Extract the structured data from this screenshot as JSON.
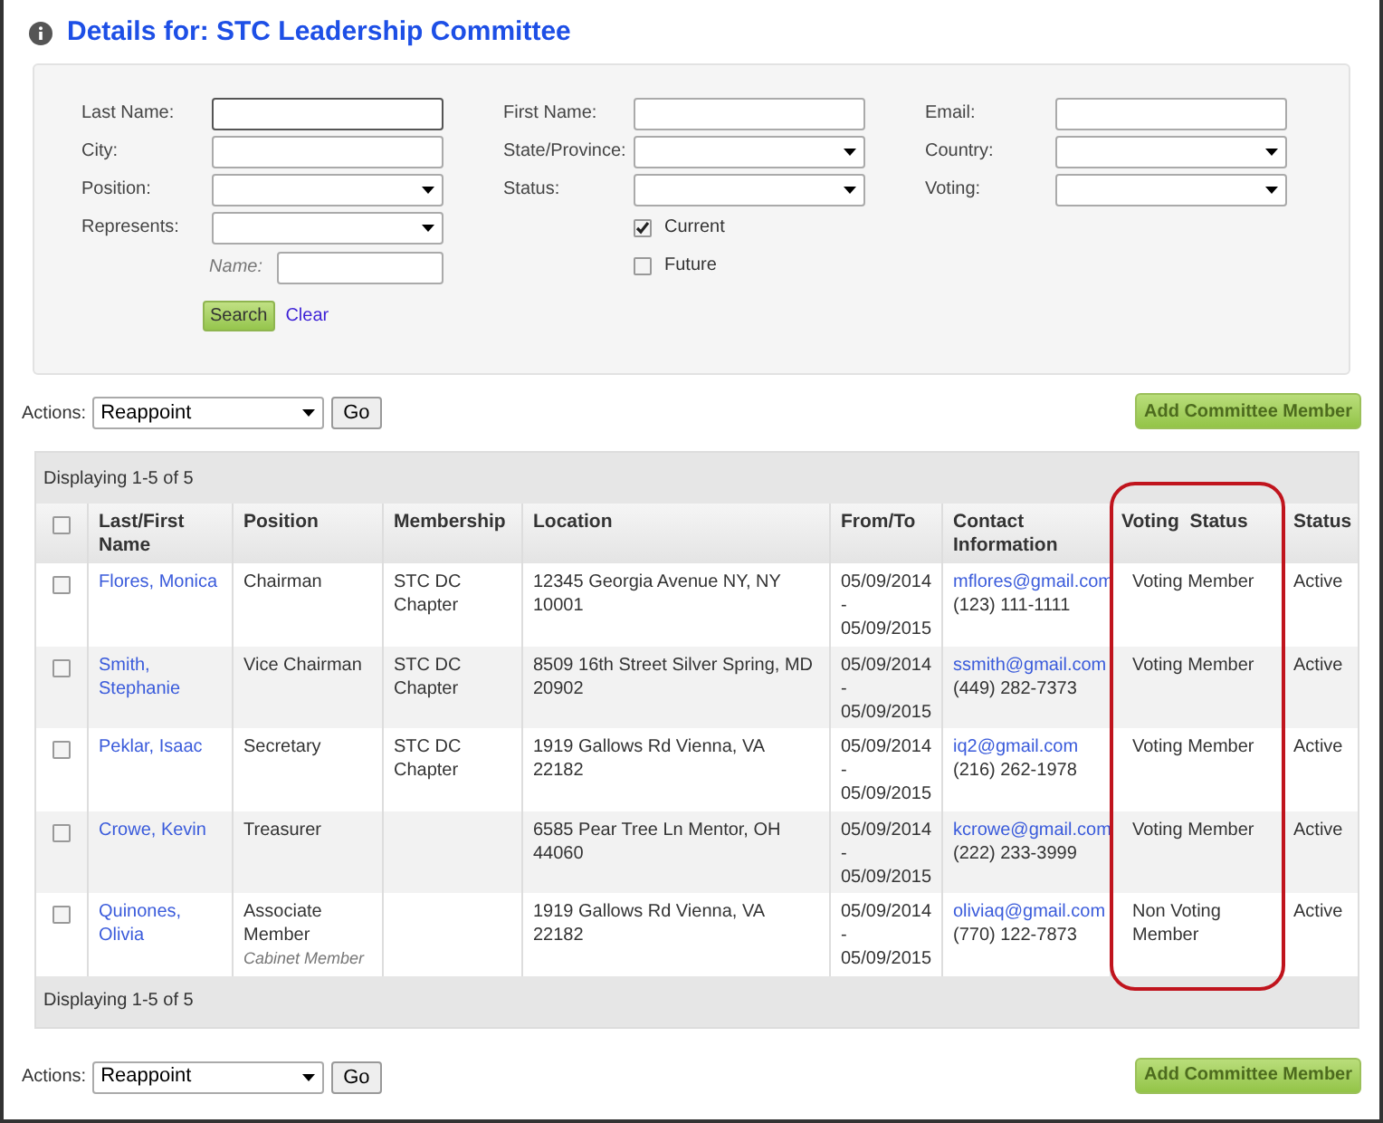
{
  "title": "Details for: STC Leadership Committee",
  "filters": {
    "columns": [
      [
        {
          "kind": "text",
          "label": "Last Name:",
          "focused": true
        },
        {
          "kind": "text",
          "label": "City:",
          "focused": false
        },
        {
          "kind": "select",
          "label": "Position:"
        },
        {
          "kind": "select",
          "label": "Represents:"
        },
        {
          "kind": "subtext",
          "label": "Name:",
          "focused": false
        }
      ],
      [
        {
          "kind": "text",
          "label": "First Name:",
          "focused": false
        },
        {
          "kind": "select",
          "label": "State/Province:"
        },
        {
          "kind": "select",
          "label": "Status:"
        },
        {
          "kind": "checkbox",
          "label": "Current",
          "checked": true
        },
        {
          "kind": "checkbox",
          "label": "Future",
          "checked": false
        }
      ],
      [
        {
          "kind": "text",
          "label": "Email:",
          "focused": false
        },
        {
          "kind": "select",
          "label": "Country:"
        },
        {
          "kind": "select",
          "label": "Voting:"
        }
      ]
    ],
    "search_button": "Search",
    "clear_link": "Clear"
  },
  "actions_top": {
    "label": "Actions:",
    "value": "Reappoint",
    "go": "Go",
    "add": "Add Committee Member"
  },
  "table": {
    "all_selected": false,
    "summary_top": "Displaying 1-5 of 5",
    "summary_bottom": "Displaying 1-5 of 5",
    "columns": [
      {
        "label": "Last/First Name",
        "highlighted": false
      },
      {
        "label": "Position",
        "highlighted": false
      },
      {
        "label": "Membership",
        "highlighted": false
      },
      {
        "label": "Location",
        "highlighted": false
      },
      {
        "label": "From/To",
        "highlighted": false
      },
      {
        "label": "Contact Information",
        "highlighted": false
      },
      {
        "label": "Voting  Status",
        "highlighted": true
      },
      {
        "label": "Status",
        "highlighted": false
      }
    ],
    "rows": [
      {
        "selected": false,
        "name": "Flores, Monica",
        "position": "Chairman",
        "membership": "STC DC Chapter",
        "location": "12345 Georgia Avenue NY, NY 10001",
        "dates": [
          "05/09/2014",
          "-",
          "05/09/2015"
        ],
        "email": "mflores@gmail.com",
        "phone": "(123) 111-1111",
        "voting": "Voting Member",
        "status": "Active"
      },
      {
        "selected": false,
        "name": "Smith, Stephanie",
        "position": "Vice Chairman",
        "membership": "STC DC Chapter",
        "location": "8509 16th Street Silver Spring, MD 20902",
        "dates": [
          "05/09/2014",
          "-",
          "05/09/2015"
        ],
        "email": "ssmith@gmail.com",
        "phone": "(449) 282-7373",
        "voting": "Voting Member",
        "status": "Active"
      },
      {
        "selected": false,
        "name": "Peklar, Isaac",
        "position": "Secretary",
        "membership": "STC DC Chapter",
        "location": "1919 Gallows Rd Vienna, VA 22182",
        "dates": [
          "05/09/2014",
          "-",
          "05/09/2015"
        ],
        "email": "iq2@gmail.com",
        "phone": "(216) 262-1978",
        "voting": "Voting Member",
        "status": "Active"
      },
      {
        "selected": false,
        "name": "Crowe, Kevin",
        "position": "Treasurer",
        "location": "6585 Pear Tree Ln Mentor, OH 44060",
        "dates": [
          "05/09/2014",
          "-",
          "05/09/2015"
        ],
        "email": "kcrowe@gmail.com",
        "phone": "(222) 233-3999",
        "voting": "Voting Member",
        "status": "Active"
      },
      {
        "selected": false,
        "name": "Quinones, Olivia",
        "position": "Associate Member",
        "position_note": "Cabinet Member",
        "location": "1919 Gallows Rd Vienna, VA 22182",
        "dates": [
          "05/09/2014",
          "-",
          "05/09/2015"
        ],
        "email": "oliviaq@gmail.com",
        "phone": "(770) 122-7873",
        "voting": "Non Voting Member",
        "status": "Active"
      }
    ]
  },
  "actions_bottom": {
    "label": "Actions:",
    "value": "Reappoint",
    "go": "Go",
    "add": "Add Committee Member"
  }
}
